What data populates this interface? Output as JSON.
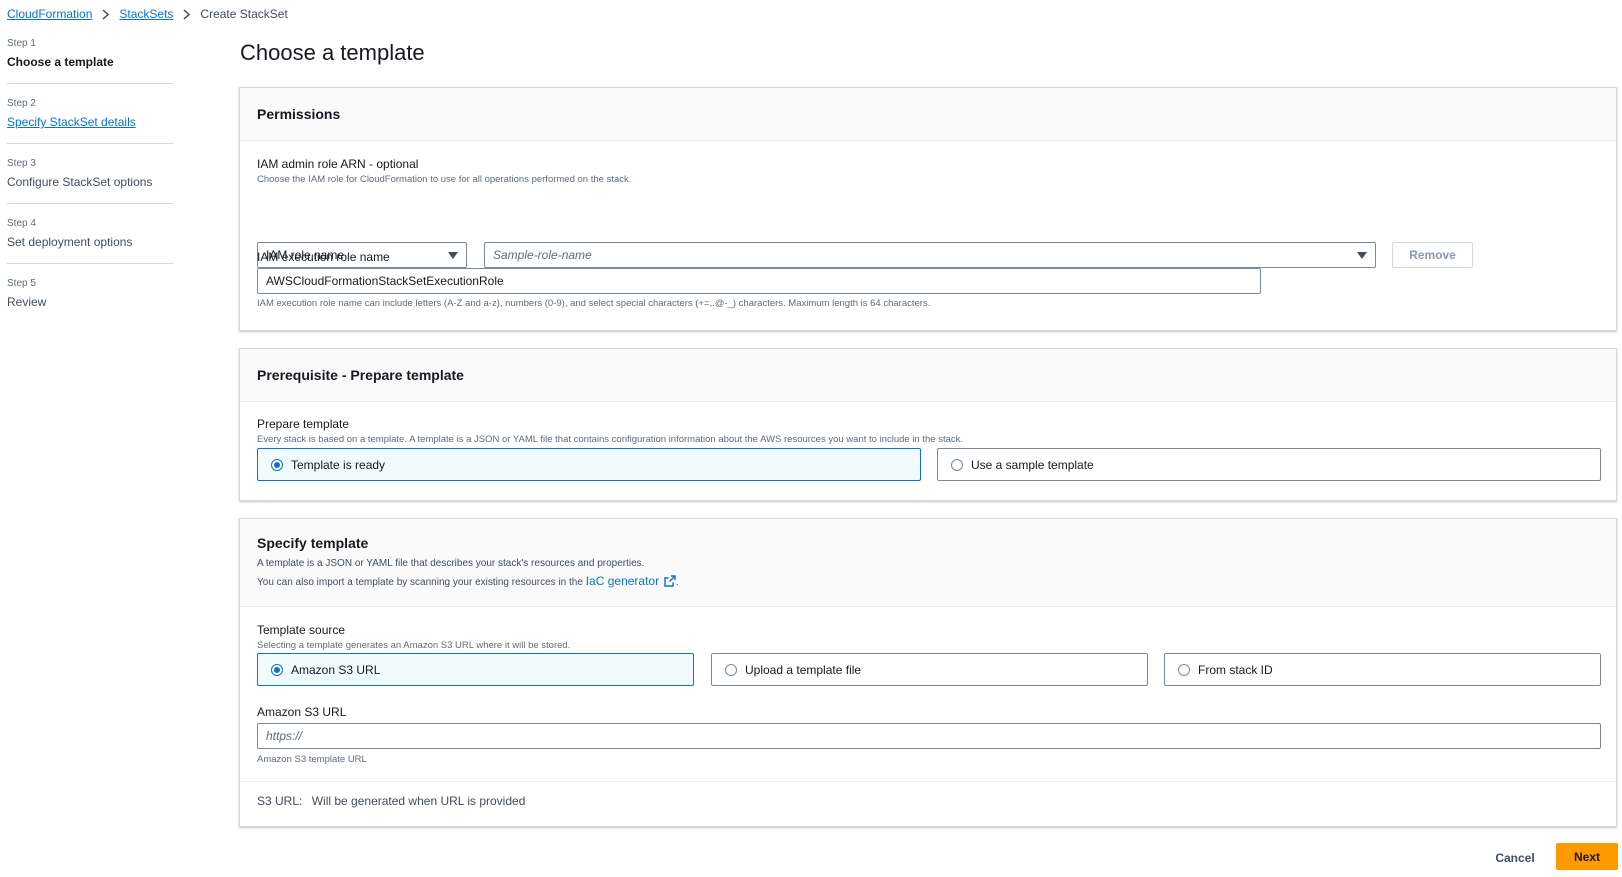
{
  "breadcrumb": {
    "items": [
      "CloudFormation",
      "StackSets"
    ],
    "current": "Create StackSet"
  },
  "steps": [
    {
      "num": "Step 1",
      "label": "Choose a template"
    },
    {
      "num": "Step 2",
      "label": "Specify StackSet details"
    },
    {
      "num": "Step 3",
      "label": "Configure StackSet options"
    },
    {
      "num": "Step 4",
      "label": "Set deployment options"
    },
    {
      "num": "Step 5",
      "label": "Review"
    }
  ],
  "page_title": "Choose a template",
  "permissions": {
    "title": "Permissions",
    "admin_role_label": "IAM admin role ARN - optional",
    "admin_role_desc": "Choose the IAM role for CloudFormation to use for all operations performed on the stack.",
    "role_type_value": "IAM role name",
    "role_name_placeholder": "Sample-role-name",
    "remove_label": "Remove",
    "exec_role_label": "IAM execution role name",
    "exec_role_value": "AWSCloudFormationStackSetExecutionRole",
    "exec_role_hint": "IAM execution role name can include letters (A-Z and a-z), numbers (0-9), and select special characters (+=,.@-_) characters. Maximum length is 64 characters."
  },
  "prerequisite": {
    "title": "Prerequisite - Prepare template",
    "label": "Prepare template",
    "desc": "Every stack is based on a template. A template is a JSON or YAML file that contains configuration information about the AWS resources you want to include in the stack.",
    "options": [
      "Template is ready",
      "Use a sample template"
    ],
    "selected": "Template is ready"
  },
  "specify": {
    "title": "Specify template",
    "desc1": "A template is a JSON or YAML file that describes your stack's resources and properties.",
    "desc2_prefix": "You can also import a template by scanning your existing resources in the",
    "desc2_link": "IaC generator",
    "desc2_suffix": ".",
    "source_label": "Template source",
    "source_desc": "Selecting a template generates an Amazon S3 URL where it will be stored.",
    "options": [
      "Amazon S3 URL",
      "Upload a template file",
      "From stack ID"
    ],
    "selected": "Amazon S3 URL",
    "url_label": "Amazon S3 URL",
    "url_placeholder": "https://",
    "url_hint": "Amazon S3 template URL",
    "s3_url_key": "S3 URL:",
    "s3_url_value": "Will be generated when URL is provided"
  },
  "footer": {
    "cancel": "Cancel",
    "next": "Next"
  },
  "colors": {
    "link": "#0972d3",
    "primary_button": "#ff9900",
    "selected_tile_bg": "#f1faff"
  }
}
